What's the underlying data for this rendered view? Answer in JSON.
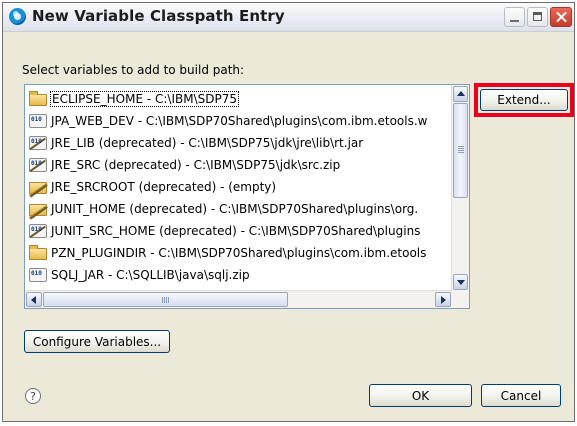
{
  "window": {
    "title": "New Variable Classpath Entry"
  },
  "instruction": "Select variables to add to build path:",
  "variables": [
    {
      "icon": "folder-icon",
      "label": "ECLIPSE_HOME - C:\\IBM\\SDP75"
    },
    {
      "icon": "jar-variable-icon",
      "label": "JPA_WEB_DEV - C:\\IBM\\SDP70Shared\\plugins\\com.ibm.etools.w"
    },
    {
      "icon": "jar-deprecated-icon",
      "label": "JRE_LIB (deprecated) - C:\\IBM\\SDP75\\jdk\\jre\\lib\\rt.jar"
    },
    {
      "icon": "jar-deprecated-icon",
      "label": "JRE_SRC (deprecated) - C:\\IBM\\SDP75\\jdk\\src.zip"
    },
    {
      "icon": "folder-deprecated-icon",
      "label": "JRE_SRCROOT (deprecated) - (empty)"
    },
    {
      "icon": "folder-deprecated-icon",
      "label": "JUNIT_HOME (deprecated) - C:\\IBM\\SDP70Shared\\plugins\\org."
    },
    {
      "icon": "jar-deprecated-icon",
      "label": "JUNIT_SRC_HOME (deprecated) - C:\\IBM\\SDP70Shared\\plugins"
    },
    {
      "icon": "folder-icon",
      "label": "PZN_PLUGINDIR - C:\\IBM\\SDP70Shared\\plugins\\com.ibm.etools"
    },
    {
      "icon": "jar-variable-icon",
      "label": "SQLJ_JAR - C:\\SQLLIB\\java\\sqlj.zip"
    }
  ],
  "buttons": {
    "extend": "Extend...",
    "configure": "Configure Variables...",
    "ok": "OK",
    "cancel": "Cancel"
  },
  "help": "?",
  "colors": {
    "highlight": "#e8001c",
    "dialog_bg": "#f1efe2",
    "button_border": "#003c74"
  }
}
